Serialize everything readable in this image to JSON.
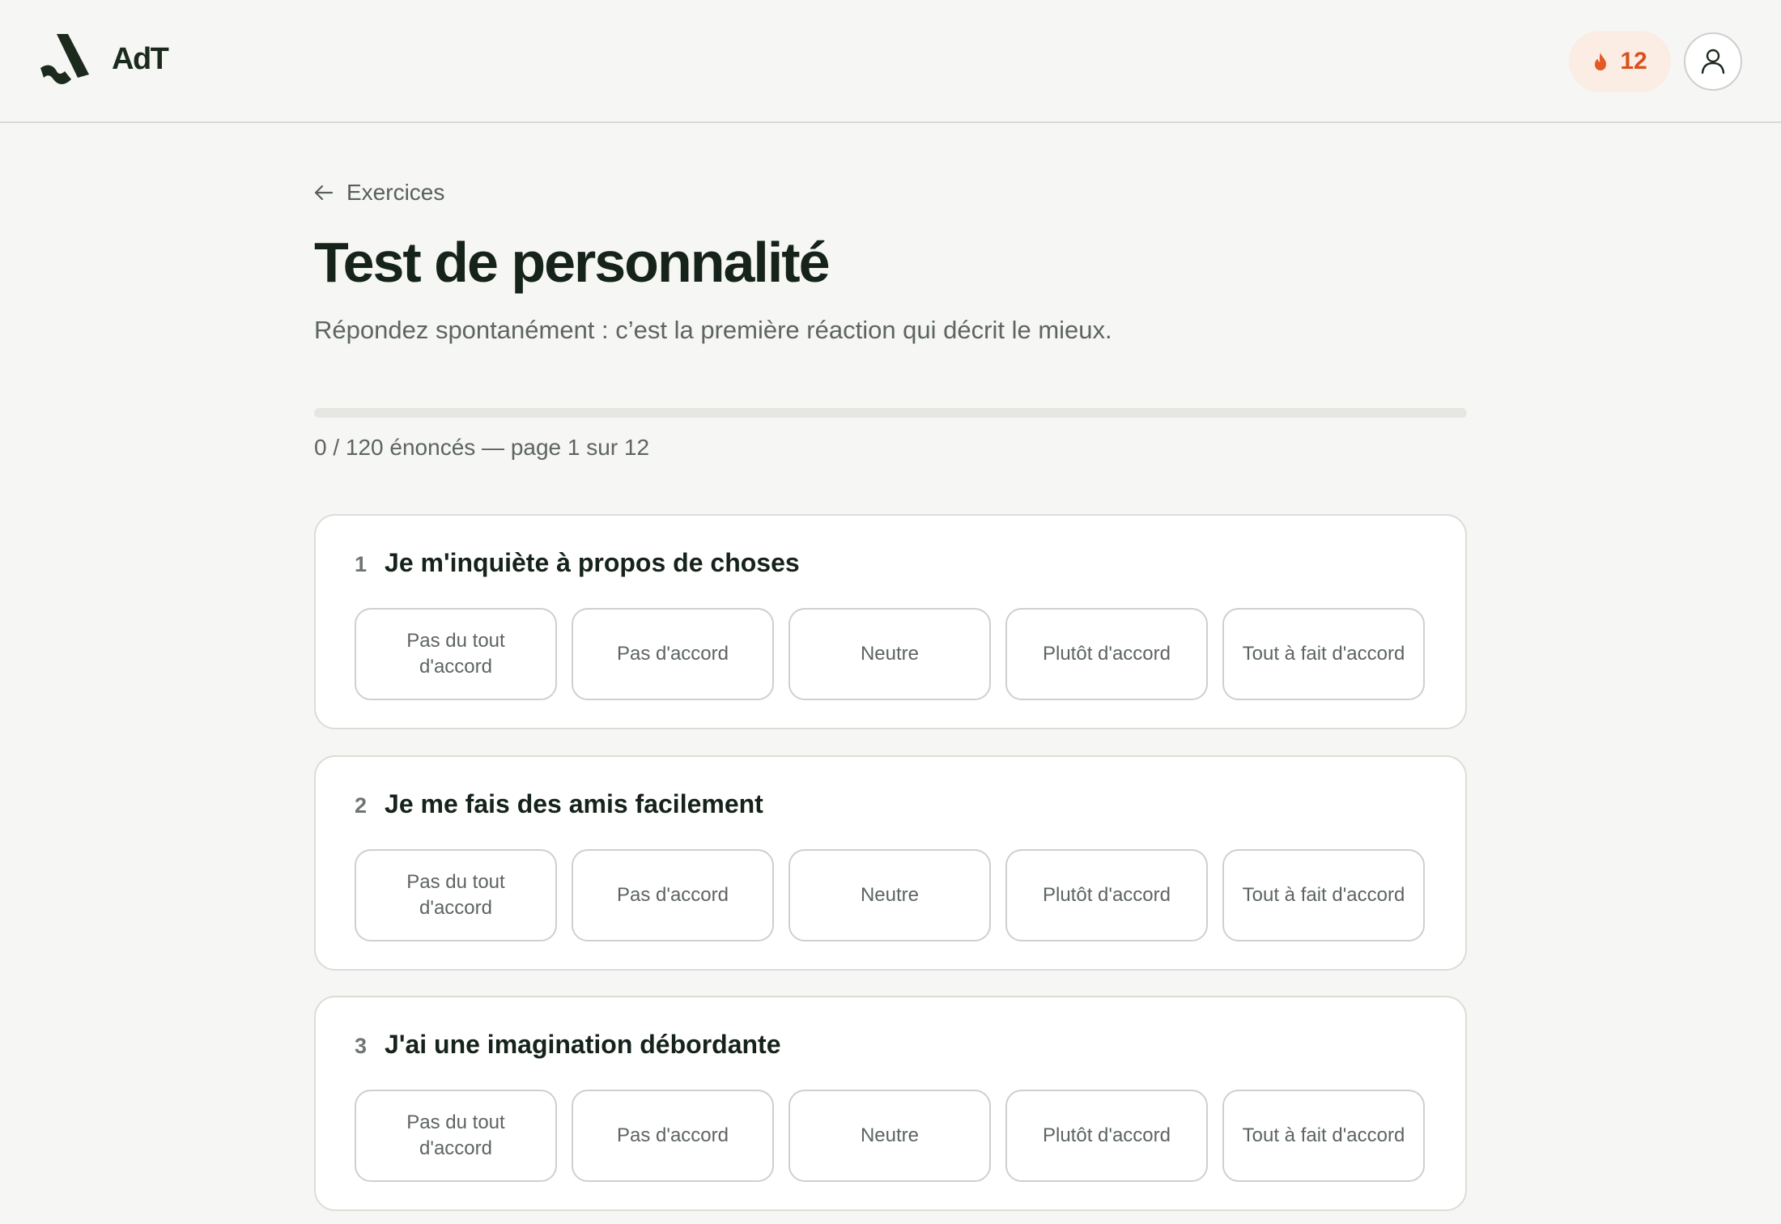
{
  "header": {
    "brand": "AdT",
    "streak_count": "12",
    "streak_icon": "flame-icon",
    "profile_icon": "user-icon"
  },
  "main": {
    "back_label": "Exercices",
    "title": "Test de personnalité",
    "subtitle": "Répondez spontanément : c’est la première réaction qui décrit le mieux.",
    "progress": {
      "answered": 0,
      "total": 120,
      "fraction": 0,
      "label": "0 / 120 énoncés — page 1 sur 12"
    },
    "questions": [
      {
        "number": "1",
        "text": "Je m'inquiète à propos de choses",
        "options": [
          "Pas du tout d'accord",
          "Pas d'accord",
          "Neutre",
          "Plutôt d'accord",
          "Tout à fait d'accord"
        ]
      },
      {
        "number": "2",
        "text": "Je me fais des amis facilement",
        "options": [
          "Pas du tout d'accord",
          "Pas d'accord",
          "Neutre",
          "Plutôt d'accord",
          "Tout à fait d'accord"
        ]
      },
      {
        "number": "3",
        "text": "J'ai une imagination débordante",
        "options": [
          "Pas du tout d'accord",
          "Pas d'accord",
          "Neutre",
          "Plutôt d'accord",
          "Tout à fait d'accord"
        ]
      }
    ]
  },
  "colors": {
    "background": "#f6f6f4",
    "brand_dark": "#1c2a1e",
    "streak_bg": "#fbece4",
    "streak_accent": "#d9521d"
  }
}
